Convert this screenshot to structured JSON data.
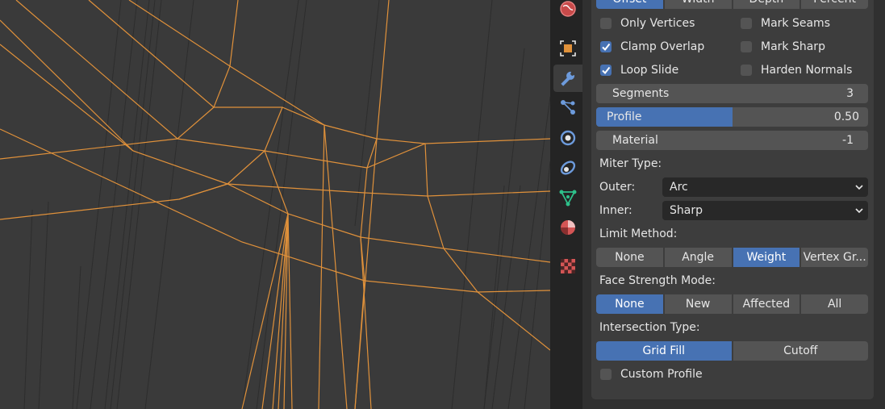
{
  "top_tabs": {
    "items": [
      {
        "label": "Offset",
        "active": true
      },
      {
        "label": "Width",
        "active": false
      },
      {
        "label": "Depth",
        "active": false
      },
      {
        "label": "Percent",
        "active": false
      }
    ]
  },
  "checkboxes": {
    "only_vertices": {
      "label": "Only Vertices",
      "checked": false
    },
    "mark_seams": {
      "label": "Mark Seams",
      "checked": false
    },
    "clamp_overlap": {
      "label": "Clamp Overlap",
      "checked": true
    },
    "mark_sharp": {
      "label": "Mark Sharp",
      "checked": false
    },
    "loop_slide": {
      "label": "Loop Slide",
      "checked": true
    },
    "harden_normals": {
      "label": "Harden Normals",
      "checked": false
    },
    "custom_profile": {
      "label": "Custom Profile",
      "checked": false
    }
  },
  "segments": {
    "label": "Segments",
    "value": "3"
  },
  "profile": {
    "label": "Profile",
    "value": "0.50",
    "fraction": 0.5
  },
  "material": {
    "label": "Material",
    "value": "-1"
  },
  "miter": {
    "heading": "Miter Type:",
    "outer_label": "Outer:",
    "outer_value": "Arc",
    "inner_label": "Inner:",
    "inner_value": "Sharp"
  },
  "limit_method": {
    "heading": "Limit Method:",
    "options": [
      {
        "label": "None",
        "active": false
      },
      {
        "label": "Angle",
        "active": false
      },
      {
        "label": "Weight",
        "active": true
      },
      {
        "label": "Vertex Gr...",
        "active": false
      }
    ]
  },
  "face_strength": {
    "heading": "Face Strength Mode:",
    "options": [
      {
        "label": "None",
        "active": true
      },
      {
        "label": "New",
        "active": false
      },
      {
        "label": "Affected",
        "active": false
      },
      {
        "label": "All",
        "active": false
      }
    ]
  },
  "intersection": {
    "heading": "Intersection Type:",
    "options": [
      {
        "label": "Grid Fill",
        "active": true
      },
      {
        "label": "Cutoff",
        "active": false
      }
    ]
  },
  "icons": [
    "world-icon",
    "object-icon",
    "modifier-wrench-icon",
    "particles-icon",
    "physics-icon",
    "constraints-icon",
    "object-data-icon",
    "material-icon",
    "texture-icon"
  ],
  "colors": {
    "accent": "#4772b3",
    "wire": "#e0913a",
    "viewport": "#3a3a3a",
    "panel": "#3d3d3d",
    "widget": "#545454"
  }
}
